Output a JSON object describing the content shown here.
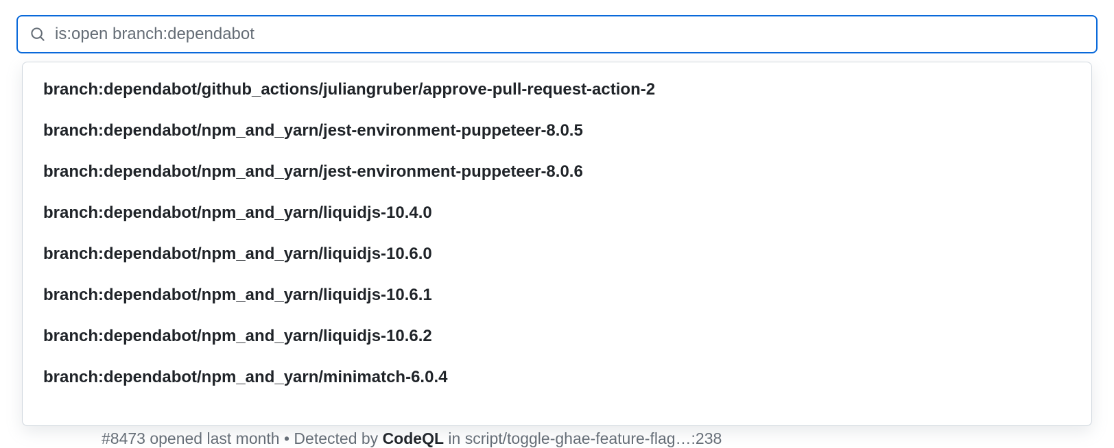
{
  "search": {
    "value": "is:open branch:dependabot"
  },
  "suggestions": [
    "branch:dependabot/github_actions/juliangruber/approve-pull-request-action-2",
    "branch:dependabot/npm_and_yarn/jest-environment-puppeteer-8.0.5",
    "branch:dependabot/npm_and_yarn/jest-environment-puppeteer-8.0.6",
    "branch:dependabot/npm_and_yarn/liquidjs-10.4.0",
    "branch:dependabot/npm_and_yarn/liquidjs-10.6.0",
    "branch:dependabot/npm_and_yarn/liquidjs-10.6.1",
    "branch:dependabot/npm_and_yarn/liquidjs-10.6.2",
    "branch:dependabot/npm_and_yarn/minimatch-6.0.4"
  ],
  "background_item": {
    "prefix": "#8473 opened last month • Detected by ",
    "detector": "CodeQL",
    "suffix": " in script/toggle-ghae-feature-flag…:238"
  }
}
